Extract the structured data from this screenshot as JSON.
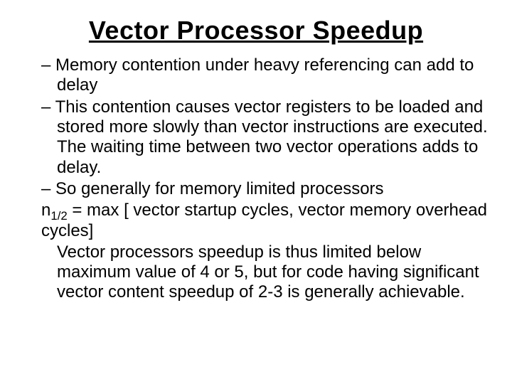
{
  "title": "Vector Processor Speedup",
  "dash": "–",
  "bullets": {
    "b1": "Memory contention  under heavy referencing can add to delay",
    "b2": " This contention causes vector registers to be loaded and stored more slowly than vector instructions are executed. The waiting time between two vector operations adds to delay.",
    "b3": "So generally for memory limited processors"
  },
  "eq": {
    "lhs": "n",
    "sub": "1/2",
    "rhs": " = max [ vector startup cycles, vector memory overhead cycles]"
  },
  "closing": "Vector processors speedup is thus limited below maximum value of 4 or 5, but for code having significant vector content speedup of 2-3 is generally achievable."
}
